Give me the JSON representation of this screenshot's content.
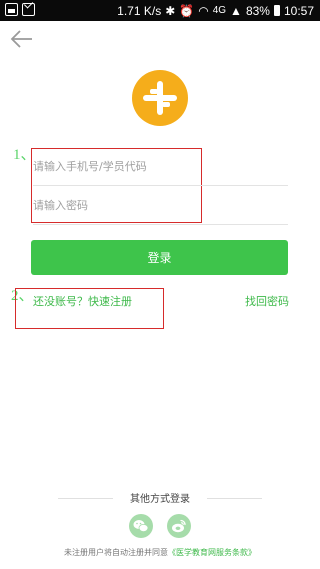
{
  "status_bar": {
    "speed": "1.71 K/s",
    "network": "4G",
    "battery": "83%",
    "time": "10:57"
  },
  "form": {
    "account_placeholder": "请输入手机号/学员代码",
    "password_placeholder": "请输入密码",
    "login_label": "登录"
  },
  "links": {
    "register": "还没账号？快速注册",
    "forgot_password": "找回密码"
  },
  "annotations": {
    "label_1": "1、",
    "label_2": "2、"
  },
  "other_login": {
    "title": "其他方式登录",
    "options": [
      "wechat-icon",
      "weibo-icon"
    ]
  },
  "terms": {
    "prefix": "未注册用户将自动注册并同意",
    "link": "《医学教育网服务条款》"
  },
  "colors": {
    "accent_green": "#3ec44b",
    "logo_orange": "#f5ad1b",
    "annotation_red": "#d62b2b"
  }
}
